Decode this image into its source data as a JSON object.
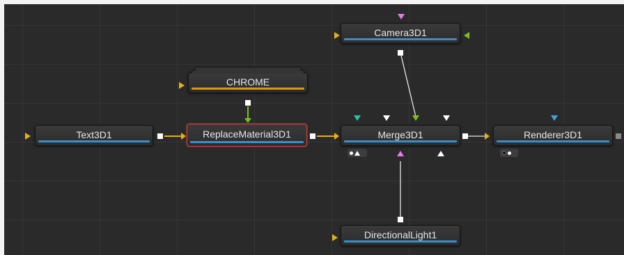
{
  "flow": {
    "nodes": {
      "camera": {
        "label": "Camera3D1"
      },
      "chrome": {
        "label": "CHROME"
      },
      "text3d": {
        "label": "Text3D1"
      },
      "replace_material": {
        "label": "ReplaceMaterial3D1"
      },
      "merge": {
        "label": "Merge3D1"
      },
      "renderer": {
        "label": "Renderer3D1"
      },
      "light": {
        "label": "DirectionalLight1"
      }
    },
    "colors": {
      "background": "#2a2a2a",
      "wire_yellow": "#e3b11c",
      "wire_green": "#79c11a",
      "wire_white": "#e8e8e8",
      "input_magenta": "#e879e8",
      "input_teal": "#29c1a8",
      "input_blue": "#3fa1e0",
      "selection_red": "#d0423a",
      "node_bar_blue": "#3a8fc9",
      "node_bar_orange": "#d49a1e"
    },
    "icons": {
      "input": "triangle-icon",
      "output": "square-icon",
      "view": "view-dot-icon"
    }
  }
}
